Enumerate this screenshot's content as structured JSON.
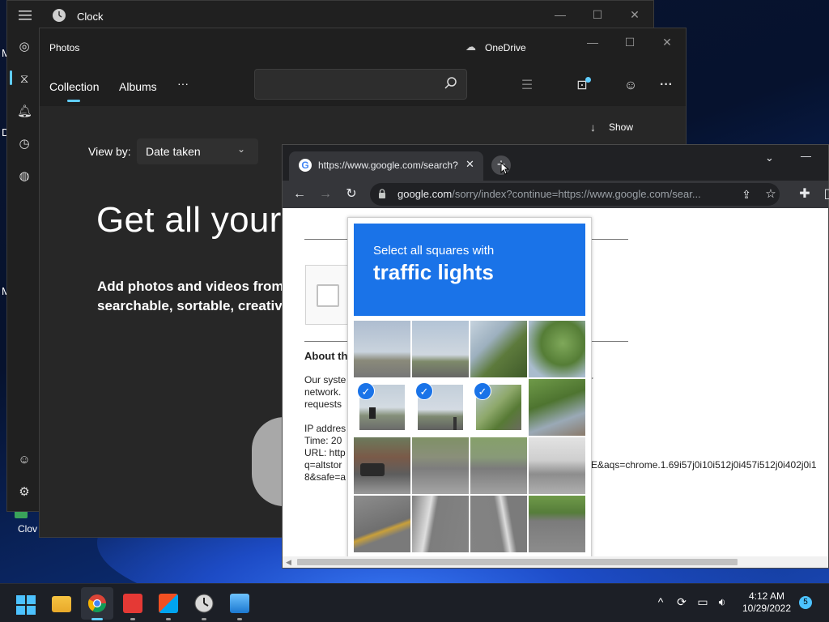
{
  "desktop": {
    "left_letters": [
      "M",
      "D",
      "M"
    ],
    "desktop_icon_label": "Clov"
  },
  "clock": {
    "title": "Clock",
    "nav_icons": [
      "focus-icon",
      "timer-icon",
      "alarm-icon",
      "stopwatch-icon",
      "world-clock-icon"
    ],
    "bottom_icons": [
      "account-icon",
      "settings-icon"
    ]
  },
  "photos": {
    "title": "Photos",
    "onedrive_label": "OneDrive",
    "tabs": [
      "Collection",
      "Albums"
    ],
    "more_label": "···",
    "show_label": "Show",
    "view_by_label": "View by:",
    "view_by_value": "Date taken",
    "hero_text": "Get all your r",
    "subtitle_line1": "Add photos and videos from",
    "subtitle_line2": "searchable, sortable, creative"
  },
  "chrome": {
    "tab_title": "https://www.google.com/search?",
    "url_domain": "google.com",
    "url_path": "/sorry/index?continue=https://www.google.com/sear...",
    "page": {
      "about_heading": "About th",
      "para_lines": [
        "Our syste",
        "network.",
        "requests"
      ],
      "para_right": "er",
      "ip_label": "IP addres",
      "time_label": "Time: 20",
      "url_label": "URL: http",
      "url_line2_left": "q=altstor",
      "url_line2_right": "E&aqs=chrome.1.69i57j0i10i512j0i457i512j0i402j0i1",
      "url_line3": "8&safe=a"
    }
  },
  "captcha": {
    "instruction": "Select all squares with",
    "target": "traffic lights",
    "check_glyph": "✓"
  },
  "taskbar": {
    "time": "4:12 AM",
    "date": "10/29/2022",
    "notification_count": "5"
  }
}
